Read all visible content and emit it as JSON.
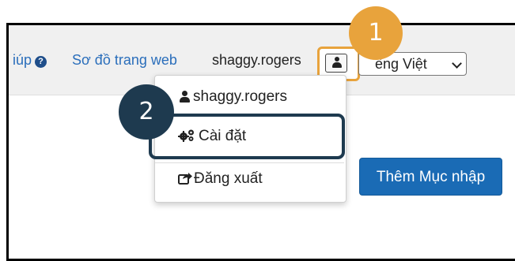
{
  "topbar": {
    "help_label": "iúp",
    "sitemap_label": "Sơ đồ trang web",
    "username": "shaggy.rogers",
    "language_label": "ếng Việt"
  },
  "user_menu": {
    "username": "shaggy.rogers",
    "settings_label": "Cài đặt",
    "logout_label": "Đăng xuất"
  },
  "main": {
    "add_entry_label": "Thêm Mục nhập"
  },
  "callouts": {
    "first": "1",
    "second": "2",
    "first_color": "#e8a33c",
    "second_color": "#1e3a4f"
  },
  "colors": {
    "link": "#2a6ebb",
    "primary_button": "#1a6bb5"
  }
}
